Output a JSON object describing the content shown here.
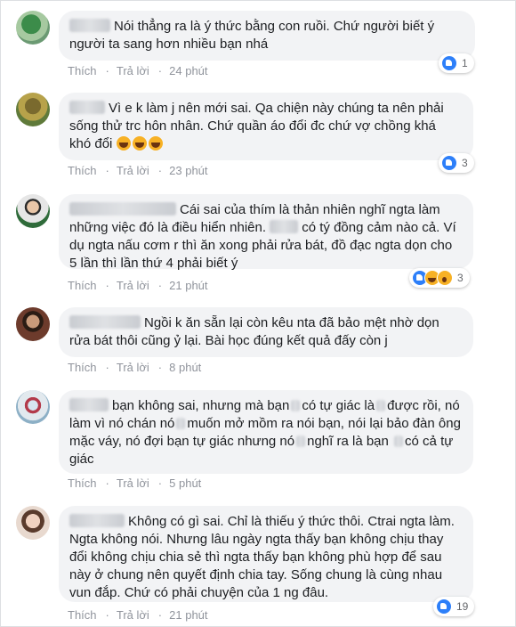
{
  "actions": {
    "like": "Thích",
    "reply": "Trả lời",
    "dot": "·"
  },
  "comments": [
    {
      "text": "Nói thẳng ra là ý thức bằng con ruồi. Chứ người biết ý người ta sang hơn nhiều bạn nhá",
      "time": "24 phút",
      "reactions": "1"
    },
    {
      "text": "Vì e k làm j nên mới sai. Qa chiện này chúng ta nên phải sống thử trc hôn nhân. Chứ quần áo đổi đc chứ vợ chồng khá khó đổi",
      "time": "23 phút",
      "reactions": "3"
    },
    {
      "text_a": "Cái sai của thím là thản nhiên nghĩ ngta làm những việc đó là điều hiển nhiên.",
      "text_b": "có tý đồng cảm nào cả. Ví dụ ngta nấu cơm r thì ăn xong phải rửa bát, đồ đạc ngta dọn cho 5 lần thì lần thứ 4 phải biết ý",
      "time": "21 phút",
      "reactions": "3"
    },
    {
      "text": "Ngồi k ăn sẵn lại còn kêu nta đã bảo mệt nhờ dọn rửa bát thôi cũng ỷ lại. Bài học đúng kết quả đấy còn j",
      "time": "8 phút"
    },
    {
      "line1a": "bạn không sai, nhưng mà bạn",
      "line1b": "có tự giác là",
      "line1c": "được rồi,",
      "line2a": "nó làm vì nó chán nó",
      "line2b": "muốn mở mồm ra nói bạn, nói lại bảo",
      "line3": "đàn ông mặc váy, nó đợi bạn tự giác nhưng nó",
      "line3b": "nghĩ ra là bạn",
      "line4": "có cả tự giác",
      "time": "5 phút"
    },
    {
      "text": "Không có gì sai. Chỉ là thiếu ý thức thôi. Ctrai ngta làm. Ngta không nói. Nhưng lâu ngày ngta thấy bạn không chịu thay đổi không chịu chia sẻ thì ngta thấy bạn không phù hợp để sau này ở chung nên quyết định chia tay. Sống chung là cùng nhau vun đắp. Chứ có phải chuyện của 1 ng đâu.",
      "time": "21 phút",
      "reactions": "19"
    }
  ],
  "colors": {
    "bubble": "#f2f3f5",
    "meta": "#90949c",
    "like_blue": "#2d7ff9"
  }
}
